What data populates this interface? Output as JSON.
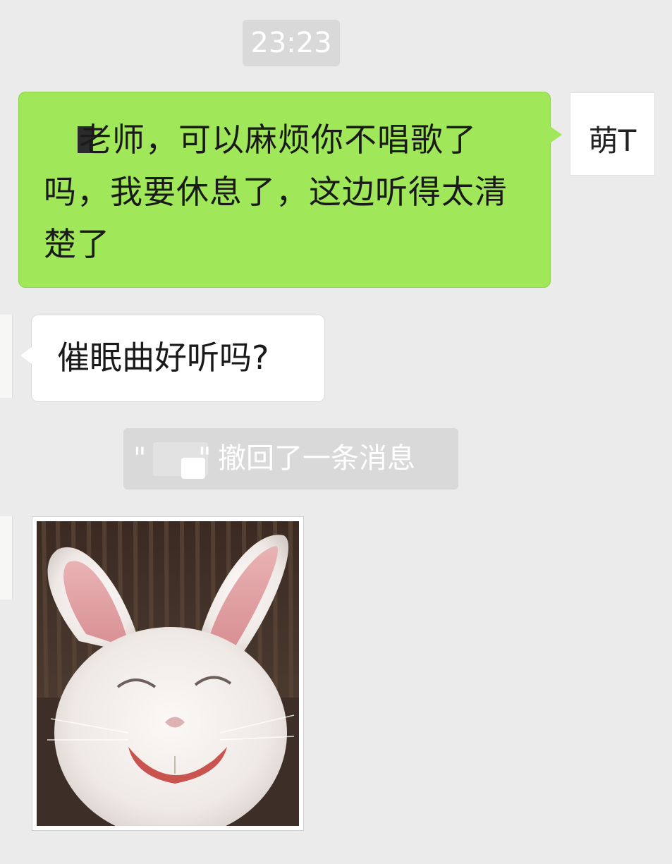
{
  "chat": {
    "timestamp": "23:23",
    "outgoing_message": "老师，可以麻烦你不唱歌了吗，我要休息了，这边听得太清楚了",
    "outgoing_avatar_text": "萌T",
    "incoming_message": "催眠曲好听吗?",
    "recall_notice": {
      "open_quote": "\"",
      "close_quote": "\"",
      "text": "撤回了一条消息"
    },
    "image_message": {
      "subject": "smiling-white-rabbit"
    }
  },
  "colors": {
    "background": "#ebebeb",
    "outgoing_bubble": "#a0e75a",
    "incoming_bubble": "#ffffff",
    "system_notice": "#d9d9d9"
  }
}
